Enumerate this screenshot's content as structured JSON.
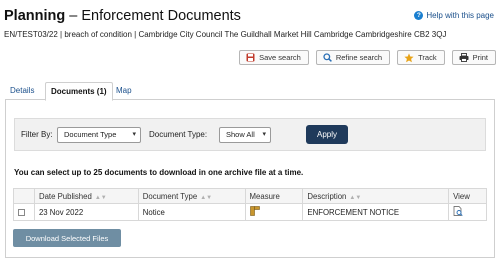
{
  "header": {
    "title_strong": "Planning",
    "title_rest": " – Enforcement Documents",
    "help_label": "Help with this page",
    "reference": "EN/TEST03/22 | breach of condition | Cambridge City Council The Guildhall Market Hill Cambridge Cambridgeshire CB2 3QJ"
  },
  "actions": [
    {
      "label": "Save search",
      "icon": "save-search-icon",
      "color": "#c0392b"
    },
    {
      "label": "Refine search",
      "icon": "magnifier-icon",
      "color": "#2a6fb5"
    },
    {
      "label": "Track",
      "icon": "star-icon",
      "color": "#e8a317"
    },
    {
      "label": "Print",
      "icon": "printer-icon",
      "color": "#333333"
    }
  ],
  "tabs": [
    {
      "label": "Details",
      "active": false
    },
    {
      "label": "Documents (1)",
      "active": true
    },
    {
      "label": "Map",
      "active": false
    }
  ],
  "filter": {
    "filter_by_label": "Filter By:",
    "filter_by_value": "Document Type",
    "doc_type_label": "Document Type:",
    "doc_type_value": "Show All",
    "apply_label": "Apply"
  },
  "note": "You can select up to 25 documents to download in one archive file at a time.",
  "table": {
    "columns": [
      "Date Published",
      "Document Type",
      "Measure",
      "Description",
      "View"
    ],
    "sortable": [
      true,
      true,
      false,
      true,
      false
    ],
    "rows": [
      {
        "date": "23 Nov 2022",
        "type": "Notice",
        "measure_icon": "measure-ruler-icon",
        "description": "ENFORCEMENT NOTICE",
        "view_icon": "view-document-icon"
      }
    ]
  },
  "download_label": "Download Selected Files",
  "colors": {
    "accent": "#1f3a5b",
    "link": "#1a4f8b",
    "download": "#6f8ea3"
  }
}
